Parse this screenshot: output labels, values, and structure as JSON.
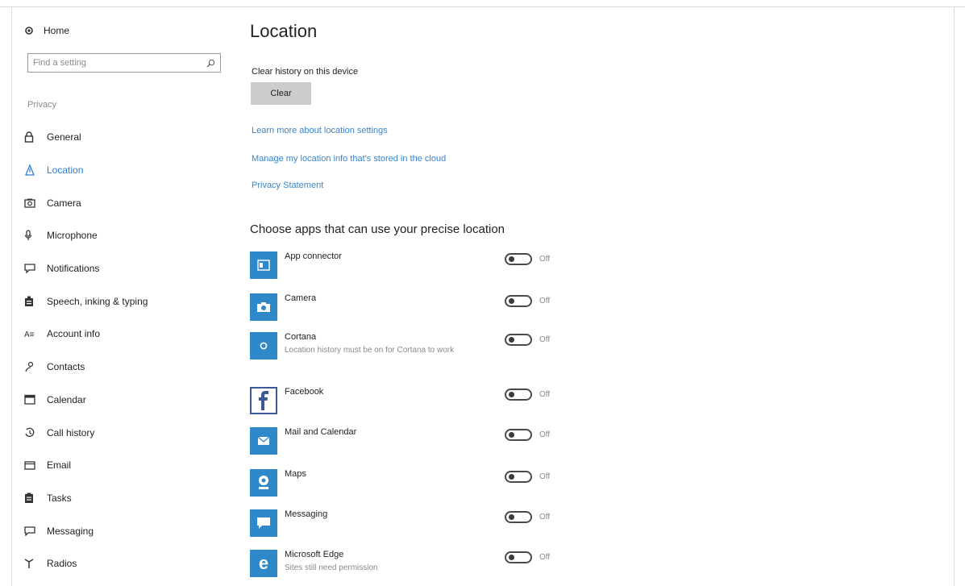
{
  "sidebar": {
    "home_label": "Home",
    "search_placeholder": "Find a setting",
    "section_label": "Privacy",
    "items": [
      {
        "label": "General",
        "icon": "lock-icon"
      },
      {
        "label": "Location",
        "icon": "location-icon",
        "active": true
      },
      {
        "label": "Camera",
        "icon": "camera-icon"
      },
      {
        "label": "Microphone",
        "icon": "microphone-icon"
      },
      {
        "label": "Notifications",
        "icon": "notifications-icon"
      },
      {
        "label": "Speech, inking & typing",
        "icon": "speech-icon"
      },
      {
        "label": "Account info",
        "icon": "account-info-icon"
      },
      {
        "label": "Contacts",
        "icon": "contacts-icon"
      },
      {
        "label": "Calendar",
        "icon": "calendar-icon"
      },
      {
        "label": "Call history",
        "icon": "call-history-icon"
      },
      {
        "label": "Email",
        "icon": "email-icon"
      },
      {
        "label": "Tasks",
        "icon": "tasks-icon"
      },
      {
        "label": "Messaging",
        "icon": "messaging-icon"
      },
      {
        "label": "Radios",
        "icon": "radios-icon"
      }
    ]
  },
  "main": {
    "title": "Location",
    "clear_history_label": "Clear history on this device",
    "clear_button": "Clear",
    "links": [
      "Learn more about location settings",
      "Manage my location info that's stored in the cloud",
      "Privacy Statement"
    ],
    "apps_heading": "Choose apps that can use your precise location",
    "apps": [
      {
        "name": "App connector",
        "sub": "",
        "state": "Off",
        "icon": "app-connector-icon"
      },
      {
        "name": "Camera",
        "sub": "",
        "state": "Off",
        "icon": "camera-app-icon"
      },
      {
        "name": "Cortana",
        "sub": "Location history must be on for Cortana to work",
        "state": "Off",
        "icon": "cortana-icon"
      },
      {
        "name": "Facebook",
        "sub": "",
        "state": "Off",
        "icon": "facebook-icon"
      },
      {
        "name": "Mail and Calendar",
        "sub": "",
        "state": "Off",
        "icon": "mail-calendar-icon"
      },
      {
        "name": "Maps",
        "sub": "",
        "state": "Off",
        "icon": "maps-icon"
      },
      {
        "name": "Messaging",
        "sub": "",
        "state": "Off",
        "icon": "messaging-app-icon"
      },
      {
        "name": "Microsoft Edge",
        "sub": "Sites still need permission",
        "state": "Off",
        "icon": "edge-icon"
      }
    ]
  },
  "colors": {
    "accent": "#2f7ed4",
    "link": "#3a84c8",
    "app_tile": "#2f88c8",
    "button": "#cccccc"
  }
}
